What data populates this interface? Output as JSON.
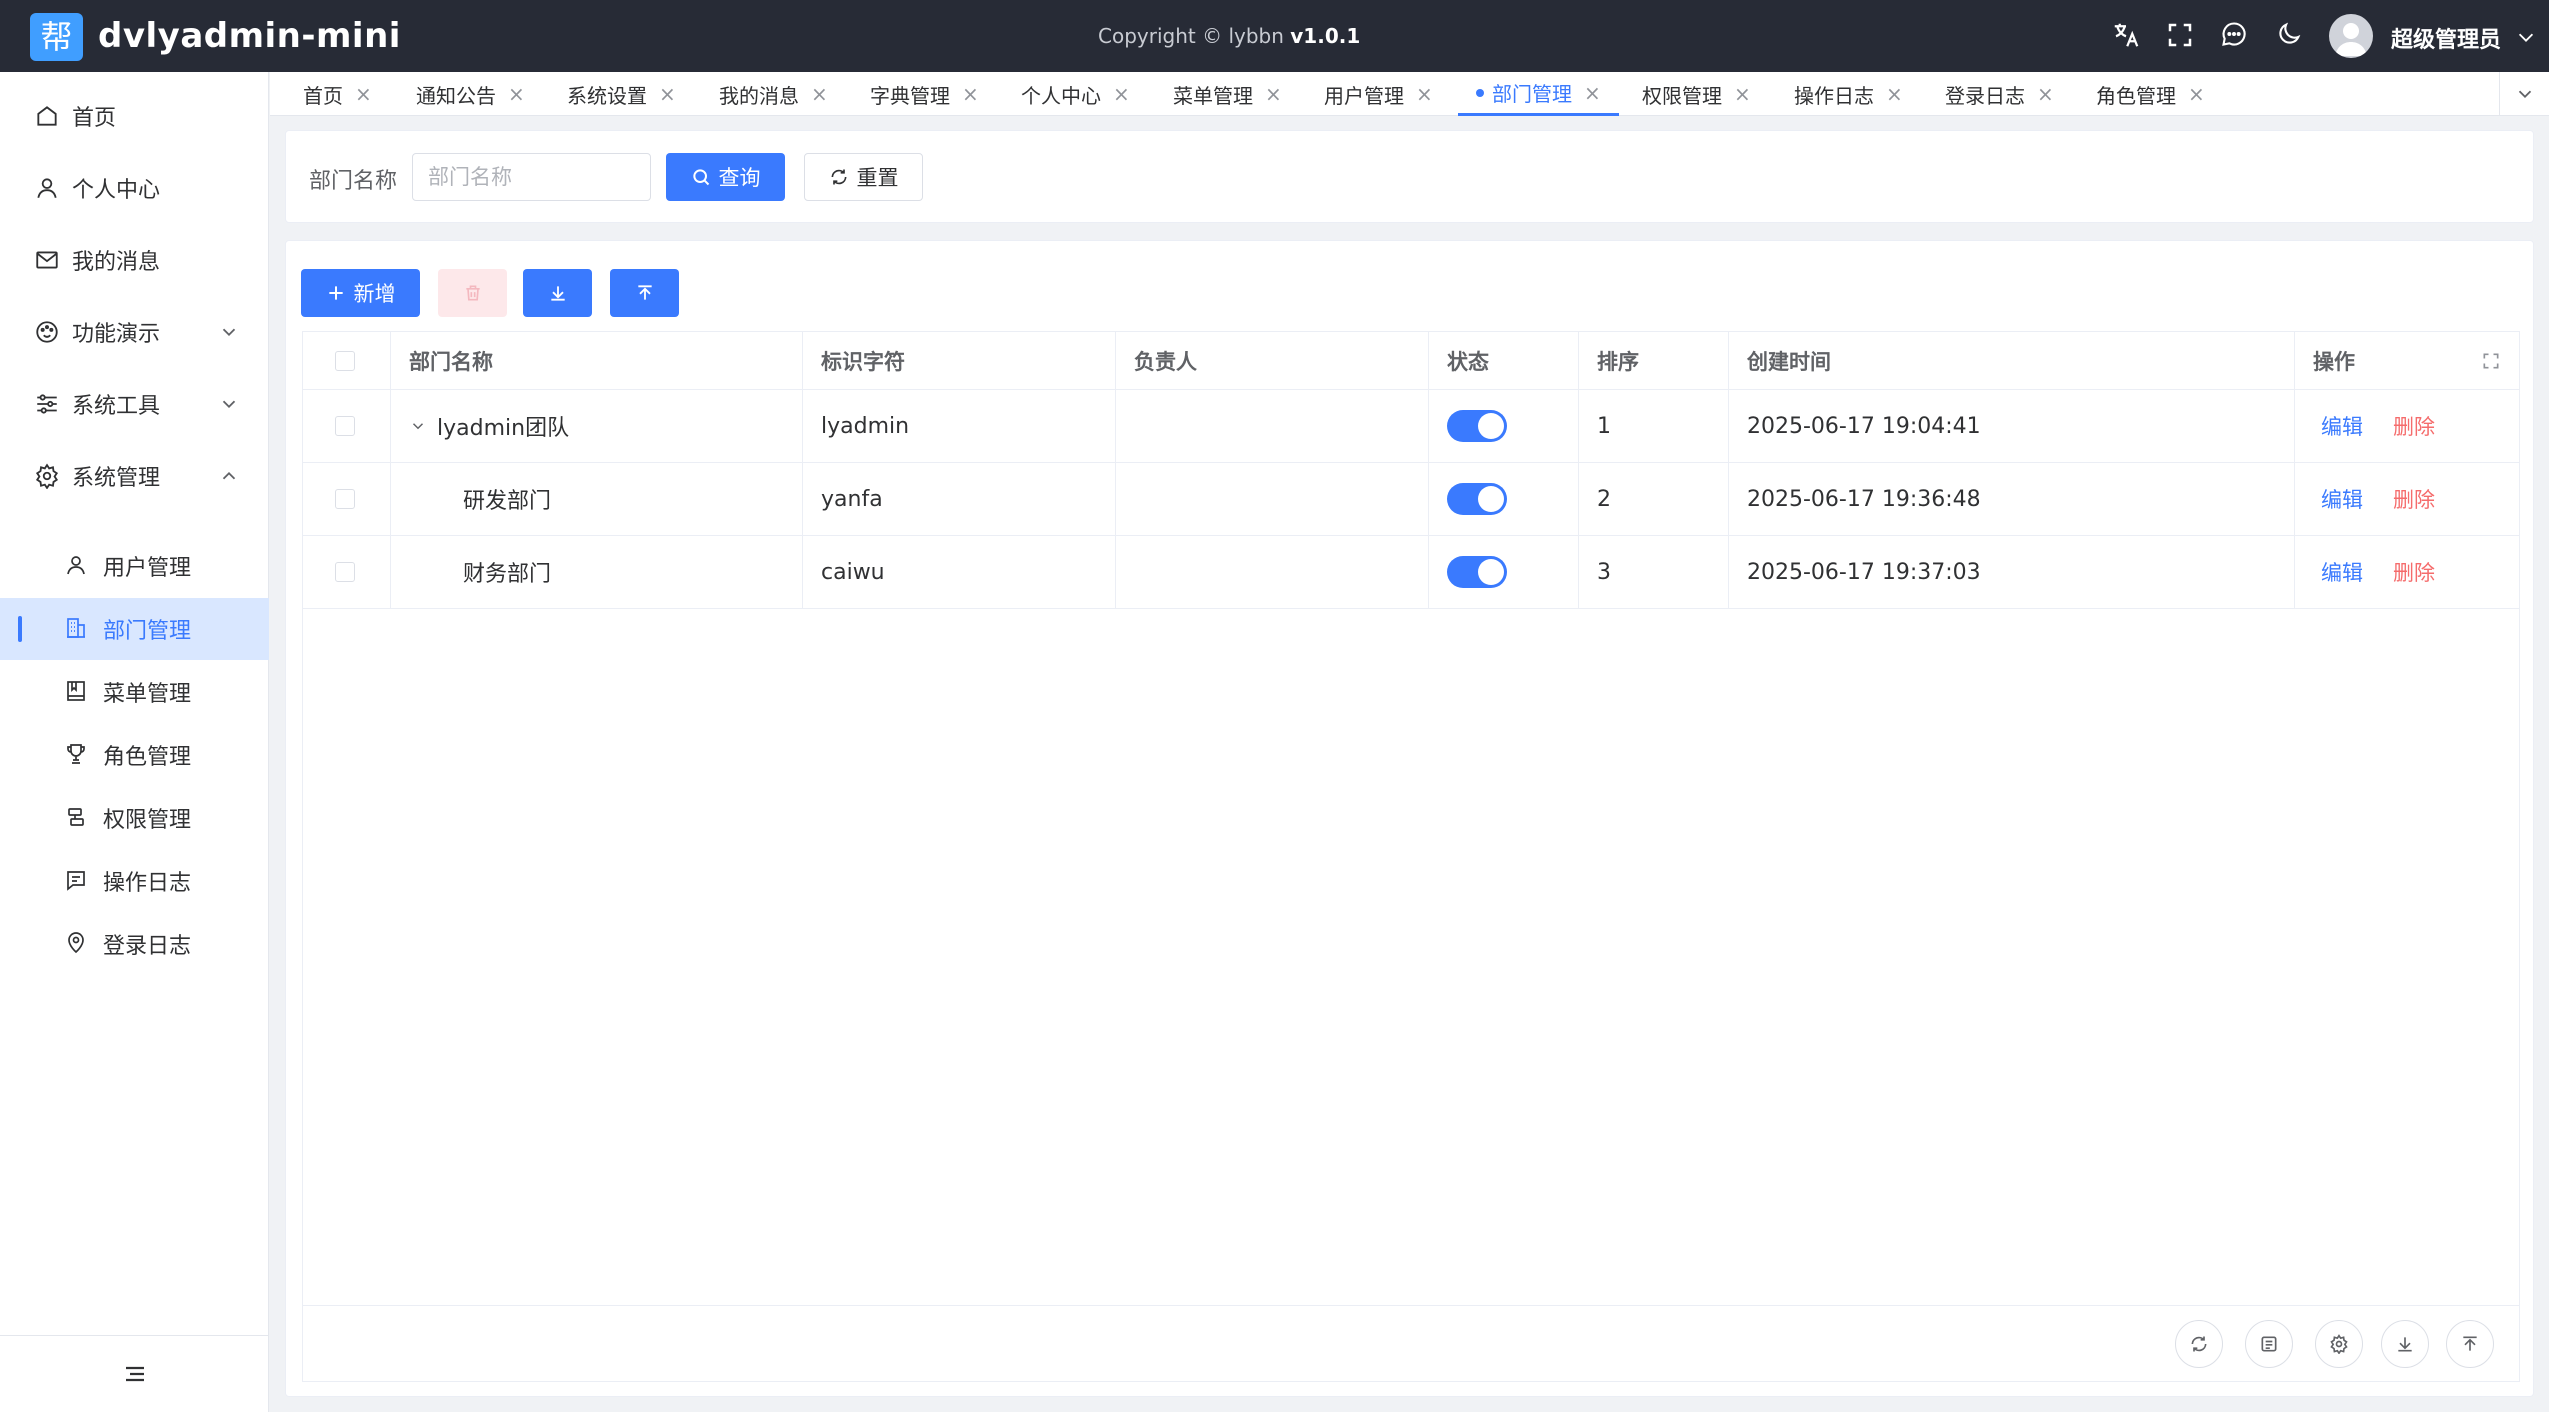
{
  "header": {
    "logo_char": "帮",
    "app_title": "dvlyadmin-mini",
    "copyright": "Copyright © lybbn",
    "version": "v1.0.1",
    "username": "超级管理员"
  },
  "sidebar": {
    "items": [
      {
        "label": "首页",
        "icon": "home-icon"
      },
      {
        "label": "个人中心",
        "icon": "user-icon"
      },
      {
        "label": "我的消息",
        "icon": "mail-icon"
      },
      {
        "label": "功能演示",
        "icon": "palette-icon",
        "expanded": false
      },
      {
        "label": "系统工具",
        "icon": "sliders-icon",
        "expanded": false
      },
      {
        "label": "系统管理",
        "icon": "gear-icon",
        "expanded": true
      }
    ],
    "sub_items": [
      {
        "label": "用户管理",
        "icon": "user-icon"
      },
      {
        "label": "部门管理",
        "icon": "building-icon",
        "active": true
      },
      {
        "label": "菜单管理",
        "icon": "book-icon"
      },
      {
        "label": "角色管理",
        "icon": "trophy-icon"
      },
      {
        "label": "权限管理",
        "icon": "permission-icon"
      },
      {
        "label": "操作日志",
        "icon": "log-icon"
      },
      {
        "label": "登录日志",
        "icon": "location-icon"
      }
    ]
  },
  "tabs": [
    {
      "label": "首页"
    },
    {
      "label": "通知公告"
    },
    {
      "label": "系统设置"
    },
    {
      "label": "我的消息"
    },
    {
      "label": "字典管理"
    },
    {
      "label": "个人中心"
    },
    {
      "label": "菜单管理"
    },
    {
      "label": "用户管理"
    },
    {
      "label": "部门管理",
      "active": true
    },
    {
      "label": "权限管理"
    },
    {
      "label": "操作日志"
    },
    {
      "label": "登录日志"
    },
    {
      "label": "角色管理"
    }
  ],
  "search": {
    "label": "部门名称",
    "placeholder": "部门名称",
    "value": "",
    "query_label": "查询",
    "reset_label": "重置"
  },
  "toolbar": {
    "add_label": "新增"
  },
  "table": {
    "columns": [
      "部门名称",
      "标识字符",
      "负责人",
      "状态",
      "排序",
      "创建时间",
      "操作"
    ],
    "rows": [
      {
        "name": "lyadmin团队",
        "key": "lyadmin",
        "leader": "",
        "status": true,
        "sort": "1",
        "created": "2025-06-17 19:04:41",
        "edit": "编辑",
        "delete": "删除"
      },
      {
        "name": "研发部门",
        "key": "yanfa",
        "leader": "",
        "status": true,
        "sort": "2",
        "created": "2025-06-17 19:36:48",
        "edit": "编辑",
        "delete": "删除"
      },
      {
        "name": "财务部门",
        "key": "caiwu",
        "leader": "",
        "status": true,
        "sort": "3",
        "created": "2025-06-17 19:37:03",
        "edit": "编辑",
        "delete": "删除"
      }
    ]
  },
  "colors": {
    "primary": "#3a7afe",
    "danger": "#f56c6c",
    "header_bg": "#272b36",
    "active_bg": "#d9e7ff"
  }
}
